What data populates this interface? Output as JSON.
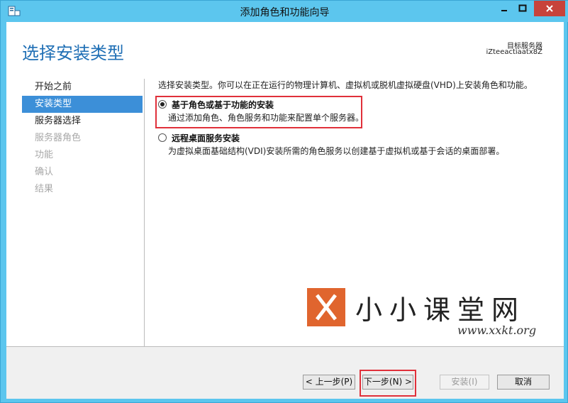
{
  "window": {
    "title": "添加角色和功能向导",
    "controls": {
      "minimize": "minimize-icon",
      "maximize": "maximize-icon",
      "close": "close-icon"
    }
  },
  "header": {
    "page_title": "选择安装类型",
    "target_label": "目标服务器",
    "target_server": "iZteeactiaatx8Z"
  },
  "nav": {
    "items": [
      {
        "label": "开始之前",
        "state": "normal"
      },
      {
        "label": "安装类型",
        "state": "active"
      },
      {
        "label": "服务器选择",
        "state": "normal"
      },
      {
        "label": "服务器角色",
        "state": "disabled"
      },
      {
        "label": "功能",
        "state": "disabled"
      },
      {
        "label": "确认",
        "state": "disabled"
      },
      {
        "label": "结果",
        "state": "disabled"
      }
    ]
  },
  "content": {
    "intro": "选择安装类型。你可以在正在运行的物理计算机、虚拟机或脱机虚拟硬盘(VHD)上安装角色和功能。",
    "options": [
      {
        "title": "基于角色或基于功能的安装",
        "description": "通过添加角色、角色服务和功能来配置单个服务器。",
        "checked": true
      },
      {
        "title": "远程桌面服务安装",
        "description": "为虚拟桌面基础结构(VDI)安装所需的角色服务以创建基于虚拟机或基于会话的桌面部署。",
        "checked": false
      }
    ]
  },
  "footer": {
    "prev": "< 上一步(P)",
    "next": "下一步(N) >",
    "install": "安装(I)",
    "cancel": "取消"
  },
  "watermark": {
    "text": "小小课堂网",
    "url": "www.xxkt.org"
  },
  "colors": {
    "accent": "#3c8fd8",
    "title_blue": "#1f6fb5",
    "frame": "#5cc6ee",
    "highlight_red": "#e0303a",
    "watermark_orange": "#e0652e"
  }
}
